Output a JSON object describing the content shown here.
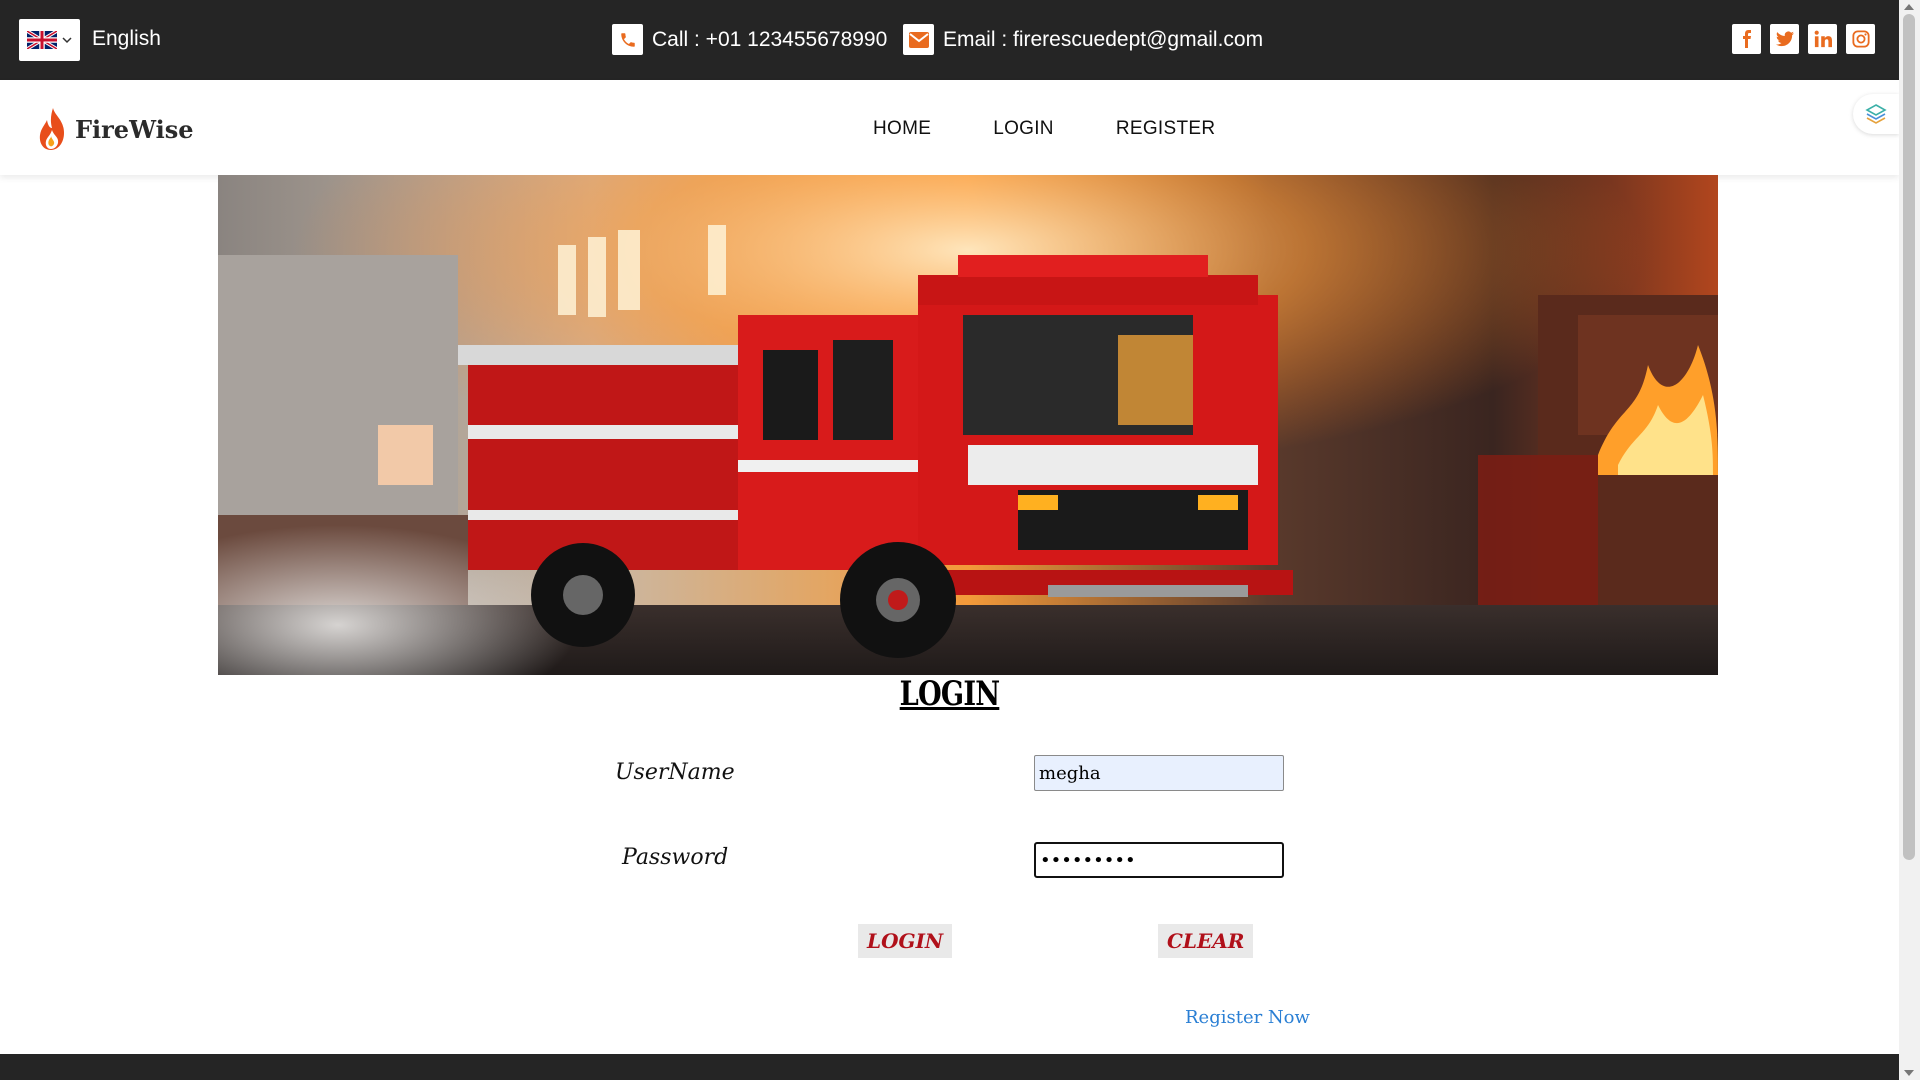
{
  "topbar": {
    "language": "English",
    "flag_icon": "uk-flag-icon",
    "call_text": "Call : +01 123455678990",
    "email_text": "Email : firerescuedept@gmail.com",
    "social_icons": [
      "facebook-icon",
      "twitter-icon",
      "linkedin-icon",
      "instagram-icon"
    ],
    "accent_color": "#e96b1f",
    "background": "#252525"
  },
  "navbar": {
    "logo_text": "FireWise",
    "links": [
      "HOME",
      "LOGIN",
      "REGISTER"
    ]
  },
  "login": {
    "title": "LOGIN",
    "username_label": "UserName",
    "username_value": "megha",
    "password_label": "Password",
    "password_value": "•••••••••",
    "login_button": "LOGIN",
    "clear_button": "CLEAR",
    "register_link": "Register Now",
    "button_text_color": "#b0101a",
    "link_color": "#2a7fd4"
  }
}
